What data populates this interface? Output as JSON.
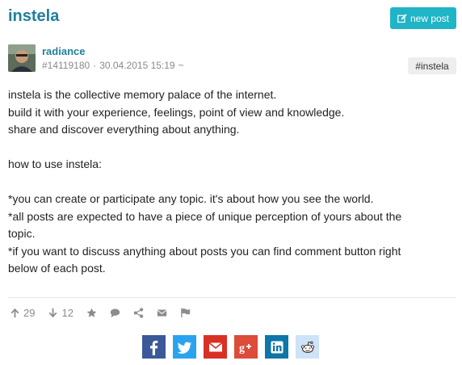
{
  "header": {
    "title": "instela",
    "new_post_label": "new post"
  },
  "post": {
    "author": "radiance",
    "id": "#14119180",
    "separator": "·",
    "date": "30.04.2015 15:19",
    "tilde": "~",
    "tag": "#instela",
    "body_lines": [
      "instela is the collective memory palace of the internet.",
      "build it with your experience, feelings, point of view and knowledge.",
      "share and discover everything about anything.",
      "",
      "how to use instela:",
      "",
      "*you can create or participate any topic. it's about how you see the world.",
      "*all posts are expected to have a piece of unique perception of yours about the",
      "topic.",
      "*if you want to discuss anything about posts you can find comment button right",
      "below of each post."
    ]
  },
  "actions": {
    "upvotes": "29",
    "downvotes": "12"
  },
  "share": [
    {
      "name": "facebook",
      "color": "#3b5998"
    },
    {
      "name": "twitter",
      "color": "#2aa3ef"
    },
    {
      "name": "email",
      "color": "#d93025"
    },
    {
      "name": "google-plus",
      "color": "#dd4b39"
    },
    {
      "name": "linkedin",
      "color": "#0e76a8"
    },
    {
      "name": "reddit",
      "color": "#cee3f8"
    }
  ],
  "colors": {
    "accent": "#1f7f9e",
    "button": "#1fb4c6"
  }
}
